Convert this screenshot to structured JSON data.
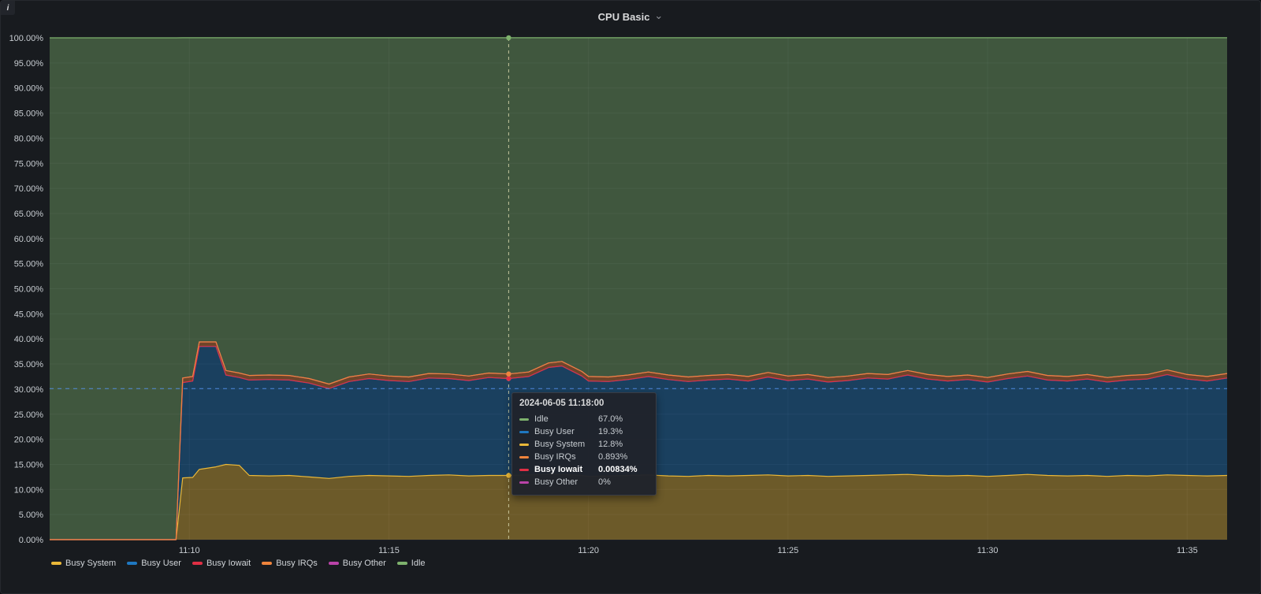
{
  "panel": {
    "title": "CPU Basic"
  },
  "icons": {
    "chevron_down": "⌄",
    "info": "i"
  },
  "colors": {
    "background": "#181b1f",
    "grid": "rgba(204,204,220,0.07)",
    "axis_text": "#c8cdd2"
  },
  "chart_data": {
    "type": "area",
    "stacked": true,
    "title": "CPU Basic",
    "unit": "percent",
    "ylim": [
      0,
      100
    ],
    "grid": true,
    "legend_position": "bottom",
    "x_axis_start": "11:06:30",
    "x_axis_end": "11:36:00",
    "y_ticks": [
      "0.00%",
      "5.00%",
      "10.00%",
      "15.00%",
      "20.00%",
      "25.00%",
      "30.00%",
      "35.00%",
      "40.00%",
      "45.00%",
      "50.00%",
      "55.00%",
      "60.00%",
      "65.00%",
      "70.00%",
      "75.00%",
      "80.00%",
      "85.00%",
      "90.00%",
      "95.00%",
      "100.00%"
    ],
    "x_ticks": [
      {
        "label": "11:10",
        "sec": 210
      },
      {
        "label": "11:15",
        "sec": 510
      },
      {
        "label": "11:20",
        "sec": 810
      },
      {
        "label": "11:25",
        "sec": 1110
      },
      {
        "label": "11:30",
        "sec": 1410
      },
      {
        "label": "11:35",
        "sec": 1710
      }
    ],
    "x_offsets_sec": [
      0,
      30,
      60,
      90,
      120,
      150,
      180,
      190,
      200,
      215,
      225,
      250,
      265,
      285,
      300,
      330,
      360,
      390,
      420,
      450,
      480,
      510,
      540,
      570,
      600,
      630,
      660,
      690,
      720,
      750,
      770,
      800,
      810,
      840,
      870,
      900,
      930,
      960,
      990,
      1020,
      1050,
      1080,
      1110,
      1140,
      1170,
      1200,
      1230,
      1260,
      1290,
      1320,
      1350,
      1380,
      1410,
      1440,
      1470,
      1500,
      1530,
      1560,
      1590,
      1620,
      1650,
      1680,
      1710,
      1740,
      1770
    ],
    "series": [
      {
        "name": "Busy System",
        "color": "#EAB839",
        "values": [
          0,
          0,
          0,
          0,
          0,
          0,
          0,
          0,
          12.3,
          12.4,
          14.0,
          14.5,
          15.0,
          14.8,
          12.8,
          12.7,
          12.8,
          12.5,
          12.2,
          12.6,
          12.8,
          12.7,
          12.6,
          12.8,
          12.9,
          12.7,
          12.8,
          12.8,
          12.9,
          13.0,
          13.0,
          12.8,
          12.6,
          12.7,
          12.8,
          12.9,
          12.7,
          12.6,
          12.8,
          12.7,
          12.8,
          12.9,
          12.7,
          12.8,
          12.6,
          12.7,
          12.8,
          12.9,
          13.0,
          12.8,
          12.7,
          12.8,
          12.6,
          12.8,
          13.0,
          12.8,
          12.7,
          12.8,
          12.6,
          12.8,
          12.7,
          12.9,
          12.8,
          12.7,
          12.8
        ]
      },
      {
        "name": "Busy User",
        "color": "#1F78C1",
        "values": [
          0,
          0,
          0,
          0,
          0,
          0,
          0,
          0,
          19.0,
          19.2,
          24.5,
          24.0,
          17.8,
          17.5,
          19.0,
          19.2,
          19.0,
          18.7,
          17.9,
          18.9,
          19.3,
          19.0,
          18.9,
          19.4,
          19.2,
          19.0,
          19.5,
          19.3,
          19.6,
          21.3,
          21.6,
          19.8,
          19.0,
          18.8,
          19.1,
          19.6,
          19.2,
          18.9,
          19.0,
          19.3,
          18.8,
          19.5,
          19.0,
          19.2,
          18.8,
          19.0,
          19.4,
          19.1,
          19.8,
          19.2,
          18.9,
          19.1,
          18.8,
          19.3,
          19.6,
          19.0,
          18.9,
          19.2,
          18.8,
          19.0,
          19.3,
          20.0,
          19.2,
          18.9,
          19.4
        ]
      },
      {
        "name": "Busy Iowait",
        "color": "#E02F44",
        "values": [
          0,
          0,
          0,
          0,
          0,
          0,
          0,
          0,
          0.01,
          0.01,
          0.01,
          0.01,
          0.01,
          0.01,
          0.01,
          0.01,
          0.01,
          0.01,
          0.01,
          0.01,
          0.01,
          0.01,
          0.01,
          0.01,
          0.01,
          0.01,
          0.01,
          0.01,
          0.01,
          0.01,
          0.01,
          0.01,
          0.01,
          0.01,
          0.01,
          0.01,
          0.01,
          0.01,
          0.01,
          0.01,
          0.01,
          0.01,
          0.01,
          0.01,
          0.01,
          0.01,
          0.01,
          0.01,
          0.01,
          0.01,
          0.01,
          0.01,
          0.01,
          0.01,
          0.01,
          0.01,
          0.01,
          0.01,
          0.01,
          0.01,
          0.01,
          0.01,
          0.01,
          0.01,
          0.01
        ]
      },
      {
        "name": "Busy IRQs",
        "color": "#EF843C",
        "values": [
          0,
          0,
          0,
          0,
          0,
          0,
          0,
          0,
          0.9,
          0.9,
          0.9,
          0.9,
          0.9,
          0.9,
          0.9,
          0.9,
          0.9,
          0.9,
          0.9,
          0.9,
          0.9,
          0.9,
          0.9,
          0.9,
          0.9,
          0.9,
          0.9,
          0.9,
          0.9,
          0.9,
          0.9,
          0.9,
          0.9,
          0.9,
          0.9,
          0.9,
          0.9,
          0.9,
          0.9,
          0.9,
          0.9,
          0.9,
          0.9,
          0.9,
          0.9,
          0.9,
          0.9,
          0.9,
          0.9,
          0.9,
          0.9,
          0.9,
          0.9,
          0.9,
          0.9,
          0.9,
          0.9,
          0.9,
          0.9,
          0.9,
          0.9,
          0.9,
          0.9,
          0.9,
          0.9
        ]
      },
      {
        "name": "Busy Other",
        "color": "#BA43A9",
        "values": [
          0,
          0,
          0,
          0,
          0,
          0,
          0,
          0,
          0,
          0,
          0,
          0,
          0,
          0,
          0,
          0,
          0,
          0,
          0,
          0,
          0,
          0,
          0,
          0,
          0,
          0,
          0,
          0,
          0,
          0,
          0,
          0,
          0,
          0,
          0,
          0,
          0,
          0,
          0,
          0,
          0,
          0,
          0,
          0,
          0,
          0,
          0,
          0,
          0,
          0,
          0,
          0,
          0,
          0,
          0,
          0,
          0,
          0,
          0,
          0,
          0,
          0,
          0,
          0,
          0
        ]
      },
      {
        "name": "Idle",
        "color": "#7EB26D",
        "values": [
          100,
          100,
          100,
          100,
          100,
          100,
          100,
          100,
          67.8,
          67.5,
          60.6,
          60.6,
          66.3,
          66.8,
          67.3,
          67.2,
          67.3,
          67.9,
          69.0,
          67.6,
          67.0,
          67.4,
          67.6,
          66.9,
          67.0,
          67.4,
          66.8,
          67.0,
          66.6,
          64.8,
          64.5,
          66.5,
          67.5,
          67.6,
          67.2,
          66.6,
          67.2,
          67.6,
          67.3,
          67.1,
          67.5,
          66.7,
          67.4,
          67.1,
          67.7,
          67.4,
          66.9,
          67.1,
          66.3,
          67.1,
          67.5,
          67.2,
          67.7,
          67.0,
          66.5,
          67.3,
          67.5,
          67.1,
          67.7,
          67.3,
          67.1,
          66.2,
          67.1,
          67.5,
          66.9
        ]
      }
    ]
  },
  "crosshair": {
    "sec": 690,
    "y_percent": 30.1
  },
  "tooltip": {
    "title": "2024-06-05 11:18:00",
    "rows": [
      {
        "label": "Idle",
        "value": "67.0%",
        "color": "#7EB26D",
        "highlight": false
      },
      {
        "label": "Busy User",
        "value": "19.3%",
        "color": "#1F78C1",
        "highlight": false
      },
      {
        "label": "Busy System",
        "value": "12.8%",
        "color": "#EAB839",
        "highlight": false
      },
      {
        "label": "Busy IRQs",
        "value": "0.893%",
        "color": "#EF843C",
        "highlight": false
      },
      {
        "label": "Busy Iowait",
        "value": "0.00834%",
        "color": "#E02F44",
        "highlight": true
      },
      {
        "label": "Busy Other",
        "value": "0%",
        "color": "#BA43A9",
        "highlight": false
      }
    ]
  }
}
